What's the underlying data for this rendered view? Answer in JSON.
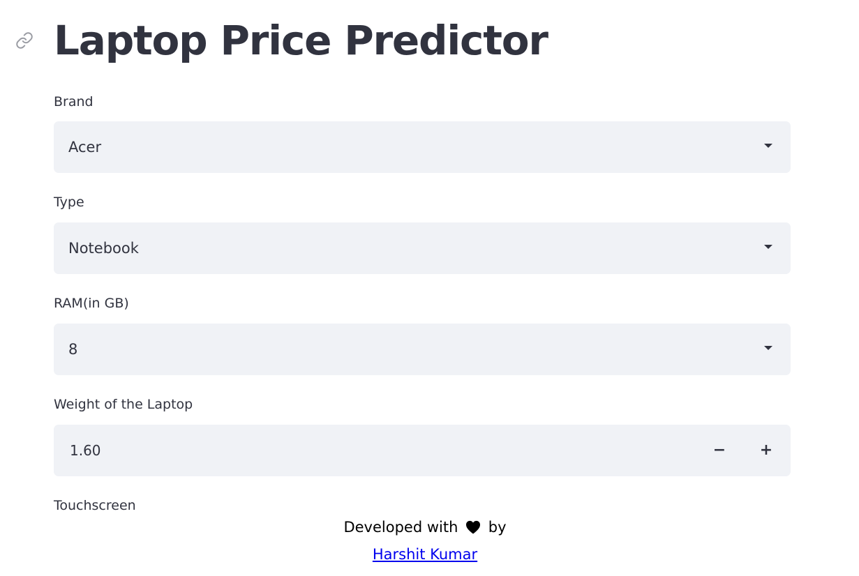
{
  "app": {
    "title": "Laptop Price Predictor"
  },
  "fields": {
    "brand": {
      "label": "Brand",
      "value": "Acer"
    },
    "type": {
      "label": "Type",
      "value": "Notebook"
    },
    "ram": {
      "label": "RAM(in GB)",
      "value": "8"
    },
    "weight": {
      "label": "Weight of the Laptop",
      "value": "1.60",
      "minus_label": "−",
      "plus_label": "+"
    },
    "touchscreen": {
      "label": "Touchscreen"
    }
  },
  "footer": {
    "text_before": "Developed with",
    "text_after": "by",
    "author": "Harshit Kumar"
  },
  "icons": {
    "anchor": "link-icon",
    "heart": "heart-icon",
    "dropdown": "chevron-down-icon"
  },
  "colors": {
    "text": "#31333f",
    "input_bg": "#f0f2f6",
    "link": "#0000ee",
    "icon_gray": "#9a9ca3"
  }
}
